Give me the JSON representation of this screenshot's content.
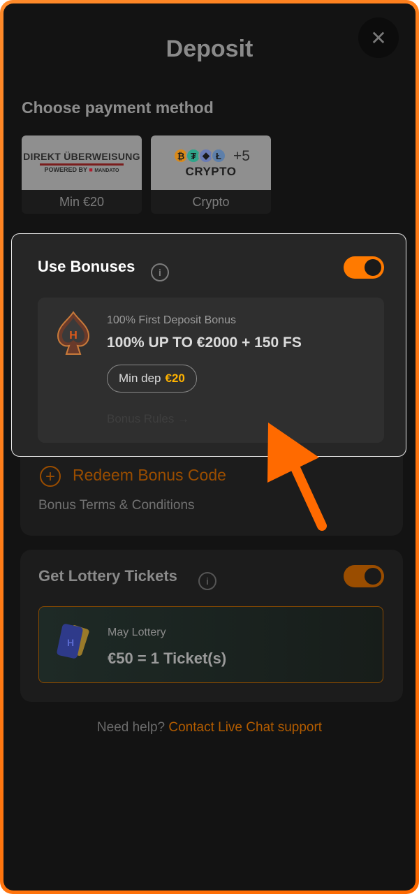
{
  "header": {
    "title": "Deposit",
    "close_icon": "close-icon"
  },
  "payment": {
    "title": "Choose payment method",
    "methods": [
      {
        "logo_line1": "DIREKT ÜBERWEISUNG",
        "logo_line2": "POWERED BY",
        "logo_brand": "MANDATO",
        "caption": "Min €20"
      },
      {
        "logo_plus": "+5",
        "logo_text": "CRYPTO",
        "caption": "Crypto"
      }
    ]
  },
  "bonuses": {
    "title": "Use Bonuses",
    "enabled": true,
    "offer": {
      "subtitle": "100% First Deposit Bonus",
      "headline": "100% UP TO €2000 + 150 FS",
      "min_dep_label": "Min dep",
      "min_dep_amount": "€20",
      "rules_link": "Bonus Rules →"
    },
    "redeem": "Redeem Bonus Code",
    "terms": "Bonus Terms & Conditions"
  },
  "lottery": {
    "title": "Get Lottery Tickets",
    "enabled": true,
    "subtitle": "May Lottery",
    "value": "€50 = 1 Ticket(s)"
  },
  "help": {
    "prefix": "Need help?",
    "link": "Contact Live Chat support"
  },
  "colors": {
    "accent": "#ff7a00",
    "frame": "#ff6a00",
    "bg": "#131313"
  }
}
